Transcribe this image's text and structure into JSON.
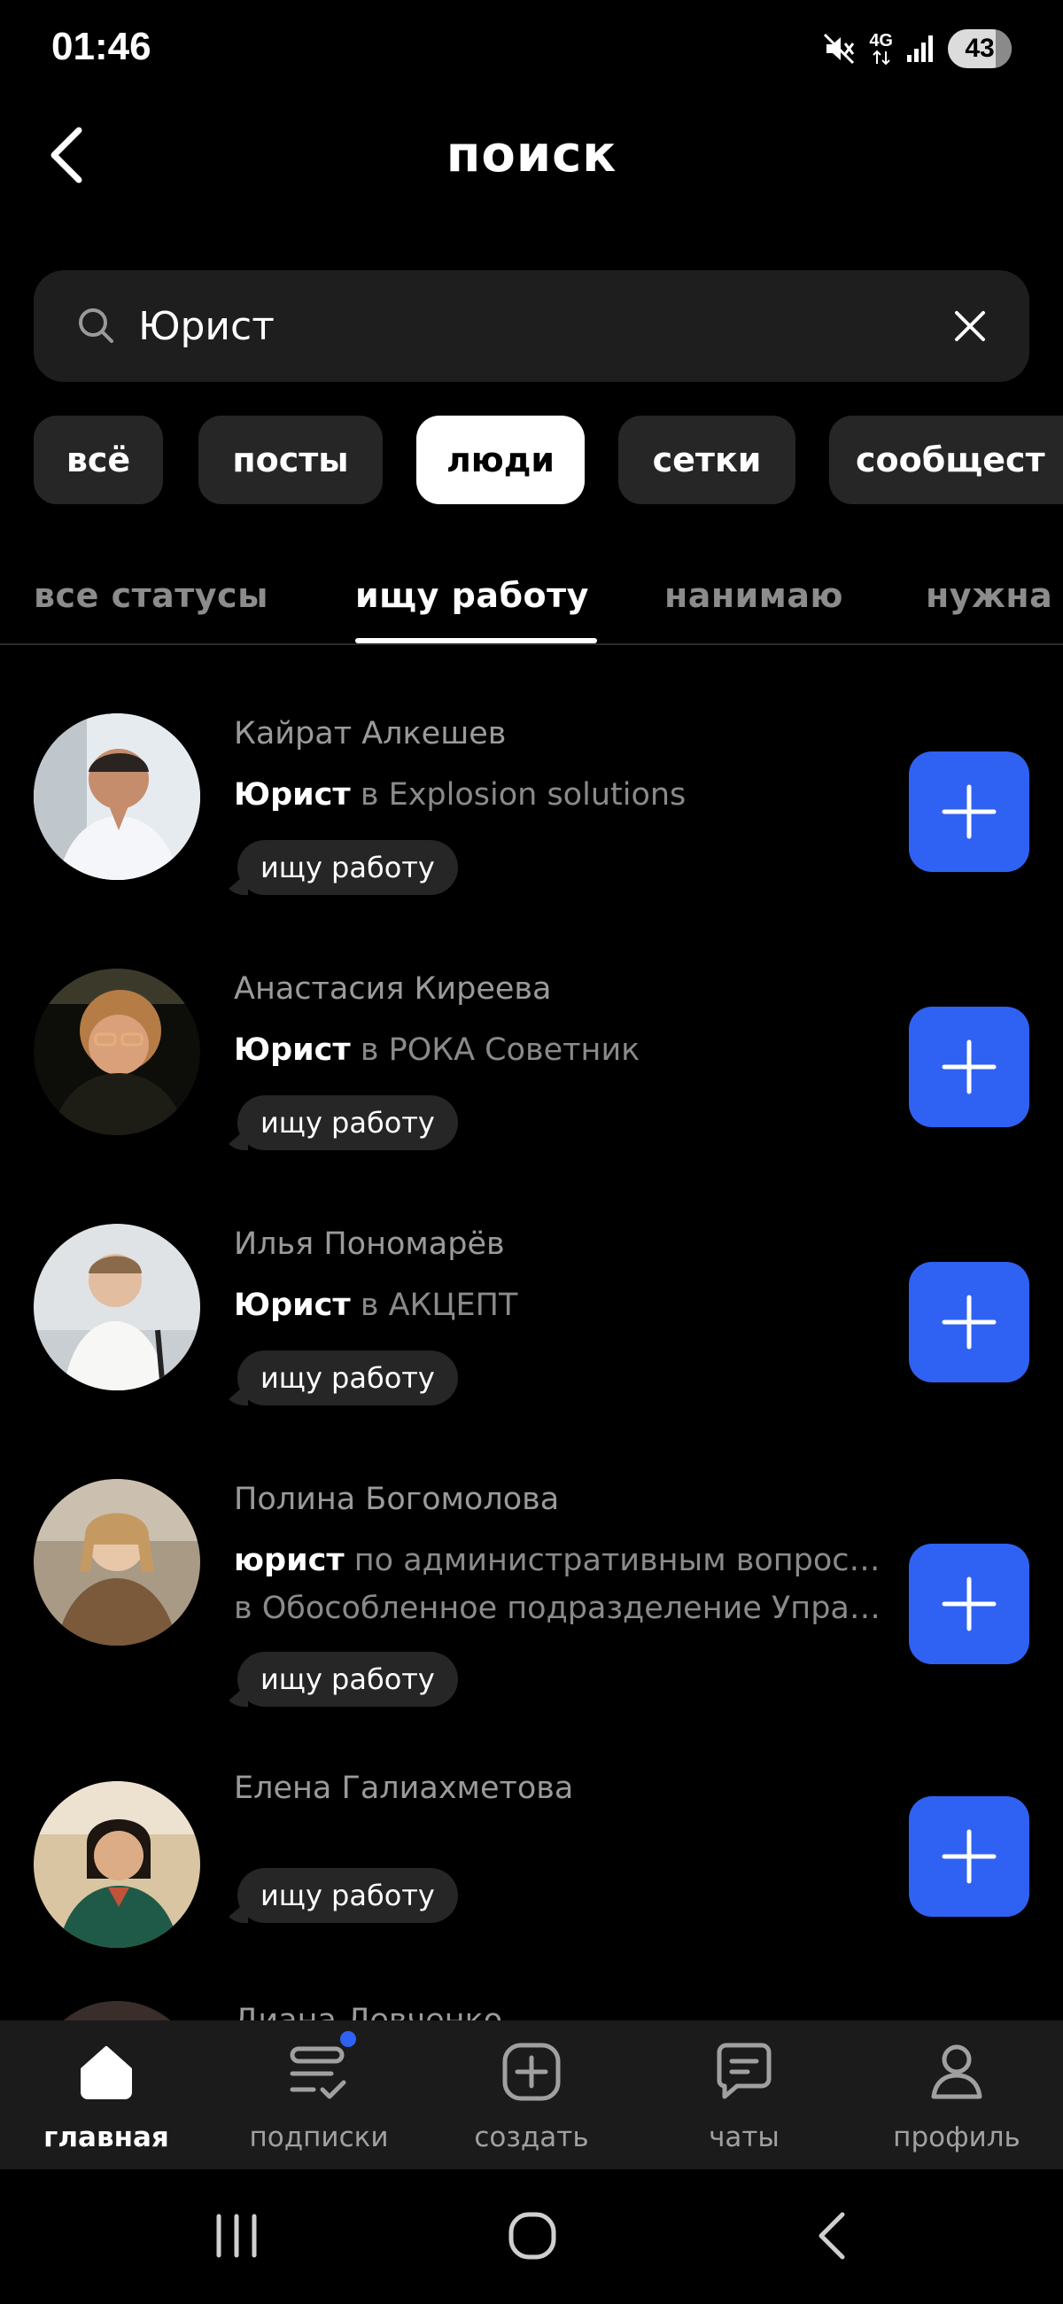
{
  "status_bar": {
    "time": "01:46",
    "network": "4G",
    "battery": "43"
  },
  "header": {
    "title": "поиск",
    "back_icon": "chevron-left-icon"
  },
  "search": {
    "value": "Юрист",
    "placeholder": "",
    "search_icon": "search-icon",
    "clear_icon": "close-icon"
  },
  "filters": [
    {
      "label": "всё",
      "active": false
    },
    {
      "label": "посты",
      "active": false
    },
    {
      "label": "люди",
      "active": true
    },
    {
      "label": "сетки",
      "active": false
    },
    {
      "label": "сообщест",
      "active": false
    }
  ],
  "status_tabs": [
    {
      "label": "все статусы",
      "active": false
    },
    {
      "label": "ищу работу",
      "active": true
    },
    {
      "label": "нанимаю",
      "active": false
    },
    {
      "label": "нужна",
      "active": false
    }
  ],
  "people": [
    {
      "name": "Кайрат Алкешев",
      "role_bold": "Юрист",
      "role_rest": " в Explosion solutions",
      "role_line2": "",
      "badge": "ищу работу"
    },
    {
      "name": "Анастасия Киреева",
      "role_bold": "Юрист",
      "role_rest": " в РОКА Советник",
      "role_line2": "",
      "badge": "ищу работу"
    },
    {
      "name": "Илья Пономарёв",
      "role_bold": "Юрист",
      "role_rest": " в АКЦЕПТ",
      "role_line2": "",
      "badge": "ищу работу"
    },
    {
      "name": "Полина Богомолова",
      "role_bold": "юрист",
      "role_rest": " по административным вопросам",
      "role_line2": "в Обособленное подразделение Управ…",
      "badge": "ищу работу"
    },
    {
      "name": "Елена Галиахметова",
      "role_bold": "",
      "role_rest": "",
      "role_line2": "",
      "badge": "ищу работу"
    },
    {
      "name": "Диана Левченко",
      "role_bold": "",
      "role_rest": "",
      "role_line2": "",
      "badge": ""
    }
  ],
  "bottom_nav": [
    {
      "label": "главная",
      "icon": "home-icon",
      "active": true
    },
    {
      "label": "подписки",
      "icon": "subscriptions-icon",
      "active": false
    },
    {
      "label": "создать",
      "icon": "plus-square-icon",
      "active": false
    },
    {
      "label": "чаты",
      "icon": "chat-icon",
      "active": false
    },
    {
      "label": "профиль",
      "icon": "profile-icon",
      "active": false
    }
  ],
  "colors": {
    "background": "#000000",
    "accent": "#2f62f2",
    "surface": "#1e1e1e",
    "chip": "#262626"
  }
}
